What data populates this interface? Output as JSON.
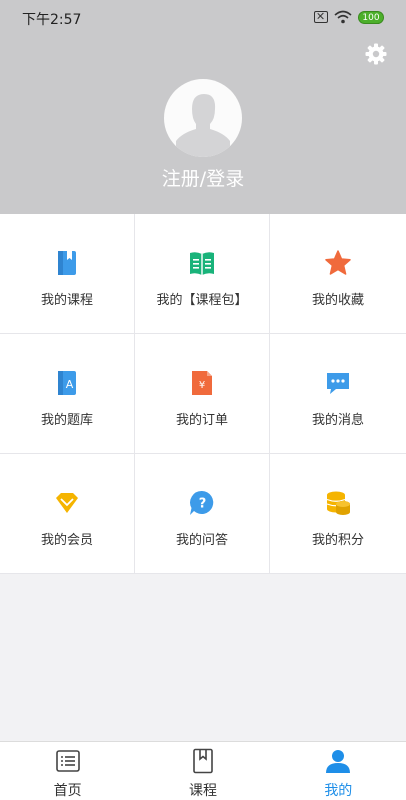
{
  "status_bar": {
    "time": "下午2:57",
    "battery": "100"
  },
  "header": {
    "login_label": "注册/登录"
  },
  "grid": {
    "items": [
      {
        "label": "我的课程",
        "icon": "course-book-icon",
        "color": "#3d9be9"
      },
      {
        "label": "我的【课程包】",
        "icon": "course-package-icon",
        "color": "#19b37a"
      },
      {
        "label": "我的收藏",
        "icon": "star-icon",
        "color": "#f06a3c"
      },
      {
        "label": "我的题库",
        "icon": "question-bank-icon",
        "color": "#3d9be9"
      },
      {
        "label": "我的订单",
        "icon": "order-icon",
        "color": "#f06a3c"
      },
      {
        "label": "我的消息",
        "icon": "message-icon",
        "color": "#3d9be9"
      },
      {
        "label": "我的会员",
        "icon": "member-diamond-icon",
        "color": "#f5b400"
      },
      {
        "label": "我的问答",
        "icon": "question-answer-icon",
        "color": "#3d9be9"
      },
      {
        "label": "我的积分",
        "icon": "points-coins-icon",
        "color": "#f5b400"
      }
    ]
  },
  "tabbar": {
    "tabs": [
      {
        "label": "首页",
        "icon": "home-list-icon"
      },
      {
        "label": "课程",
        "icon": "course-tab-icon"
      },
      {
        "label": "我的",
        "icon": "profile-icon",
        "active": true
      }
    ]
  },
  "colors": {
    "accent": "#1e8ee8",
    "header_bg": "#c9c9cb"
  }
}
